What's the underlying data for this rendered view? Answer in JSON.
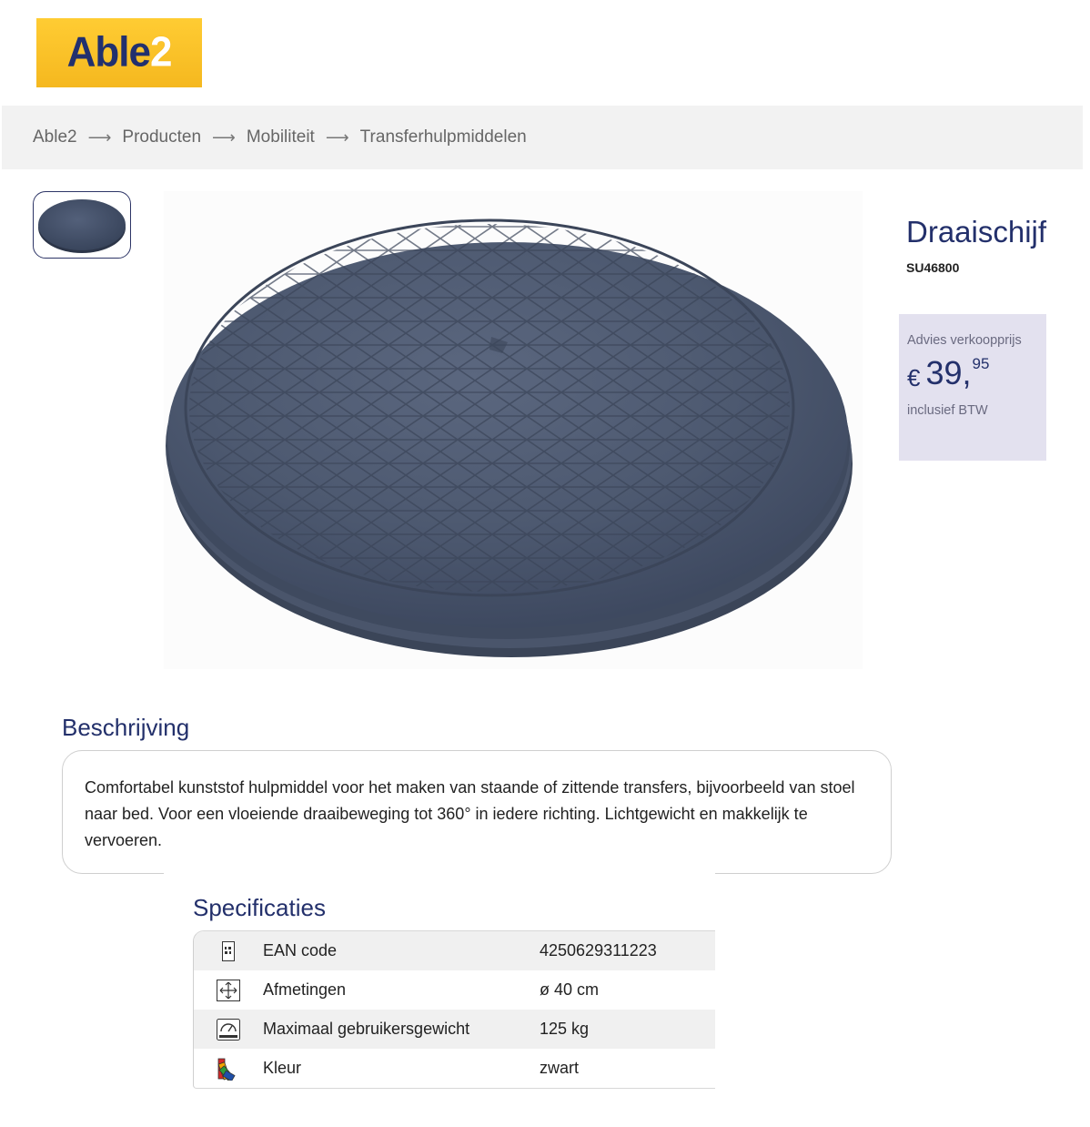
{
  "logo": {
    "text": "Able",
    "number": "2"
  },
  "breadcrumb": {
    "items": [
      "Able2",
      "Producten",
      "Mobiliteit",
      "Transferhulpmiddelen"
    ],
    "separator": "⟶"
  },
  "product": {
    "title": "Draaischijf",
    "sku": "SU46800",
    "image": "grey-rotating-disc",
    "price": {
      "label": "Advies verkoopprijs",
      "currency": "€",
      "whole": "39,",
      "cents": "95",
      "vat_note": "inclusief BTW"
    }
  },
  "description": {
    "title": "Beschrijving",
    "text": "Comfortabel kunststof hulpmiddel voor het maken van staande of zittende transfers, bijvoorbeeld van stoel naar bed. Voor een vloeiende draaibeweging tot 360° in iedere richting. Lichtgewicht en makkelijk te vervoeren."
  },
  "specs": {
    "title": "Specificaties",
    "rows": [
      {
        "icon": "barcode-icon",
        "label": "EAN code",
        "value": "4250629311223"
      },
      {
        "icon": "dimensions-icon",
        "label": "Afmetingen",
        "value": "ø 40 cm"
      },
      {
        "icon": "scale-icon",
        "label": "Maximaal gebruikersgewicht",
        "value": "125 kg"
      },
      {
        "icon": "color-palette-icon",
        "label": "Kleur",
        "value": "zwart"
      }
    ]
  },
  "colors": {
    "brand_navy": "#23306b",
    "logo_yellow": "#ffcc33",
    "price_box_bg": "#e3e1ef",
    "breadcrumb_bg": "#f2f2f2"
  }
}
